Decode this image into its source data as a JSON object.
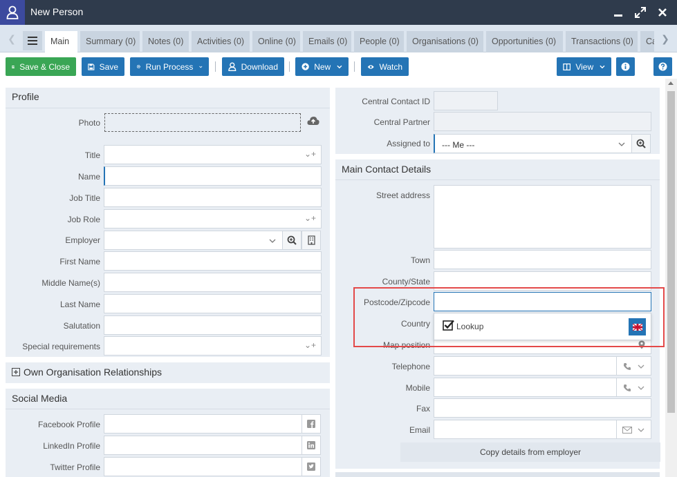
{
  "window": {
    "title": "New Person"
  },
  "tabs": [
    "Main",
    "Summary (0)",
    "Notes (0)",
    "Activities (0)",
    "Online (0)",
    "Emails (0)",
    "People (0)",
    "Organisations (0)",
    "Opportunities (0)",
    "Transactions (0)",
    "Ca"
  ],
  "toolbar": {
    "save_close": "Save & Close",
    "save": "Save",
    "run_process": "Run Process",
    "download": "Download",
    "new": "New",
    "watch": "Watch",
    "view": "View"
  },
  "profile": {
    "heading": "Profile",
    "photo": "Photo",
    "title": "Title",
    "name": "Name",
    "job_title": "Job Title",
    "job_role": "Job Role",
    "employer": "Employer",
    "first_name": "First Name",
    "middle_names": "Middle Name(s)",
    "last_name": "Last Name",
    "salutation": "Salutation",
    "special_requirements": "Special requirements"
  },
  "own_org": {
    "heading": "Own Organisation Relationships"
  },
  "social": {
    "heading": "Social Media",
    "facebook": "Facebook Profile",
    "linkedin": "LinkedIn Profile",
    "twitter": "Twitter Profile"
  },
  "central": {
    "contact_id": "Central Contact ID",
    "partner": "Central Partner",
    "assigned_to": "Assigned to",
    "assigned_value": "--- Me ---"
  },
  "main_contact": {
    "heading": "Main Contact Details",
    "street": "Street address",
    "town": "Town",
    "county": "County/State",
    "postcode": "Postcode/Zipcode",
    "country": "Country",
    "map_position": "Map position",
    "telephone": "Telephone",
    "mobile": "Mobile",
    "fax": "Fax",
    "email": "Email",
    "copy_details": "Copy details from employer"
  },
  "popup": {
    "lookup": "Lookup"
  },
  "colors": {
    "titlebar": "#2f3b4c",
    "accent_blue": "#2474b5",
    "green": "#3aa655",
    "highlight": "#e34848"
  }
}
